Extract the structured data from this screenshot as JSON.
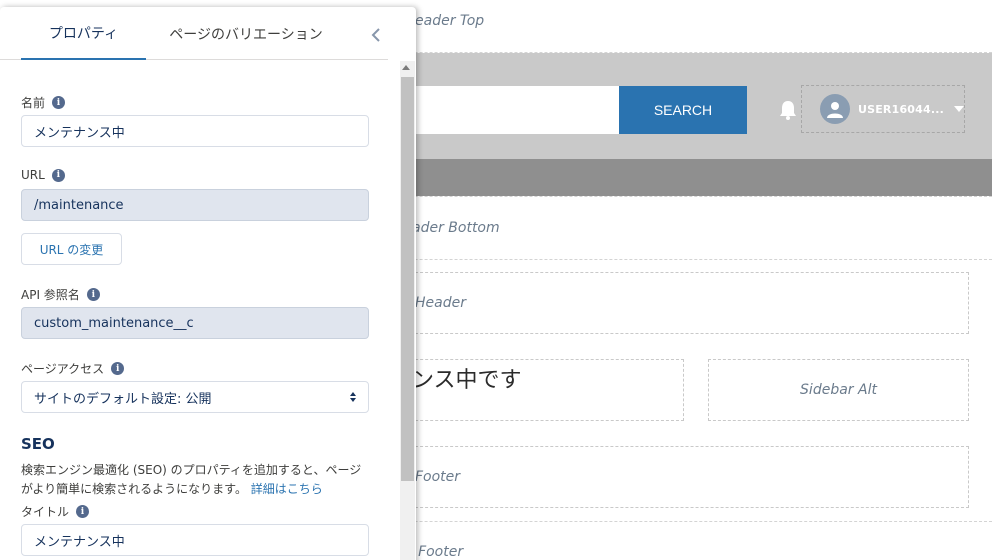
{
  "canvas": {
    "header_top_label": "eader Top",
    "header_bottom_label": "ader Bottom",
    "content_header_label": "Header",
    "main_text": "ンス中です",
    "sidebar_alt_label": "Sidebar Alt",
    "content_footer_label": "Footer",
    "footer_label": "e Footer",
    "search_button_label": "SEARCH",
    "user_name": "USER16044...",
    "icons": [
      "bell-icon",
      "user-avatar-icon",
      "chevron-down-icon"
    ]
  },
  "panel": {
    "tabs": [
      {
        "label": "プロパティ",
        "active": true
      },
      {
        "label": "ページのバリエーション",
        "active": false
      }
    ],
    "collapse_icon": "chevron-left-icon",
    "fields": {
      "name": {
        "label": "名前",
        "value": "メンテナンス中"
      },
      "url": {
        "label": "URL",
        "value": "/maintenance"
      },
      "url_change_button": "URL の変更",
      "api_name": {
        "label": "API 参照名",
        "value": "custom_maintenance__c"
      },
      "page_access": {
        "label": "ページアクセス",
        "value": "サイトのデフォルト設定: 公開"
      }
    },
    "seo": {
      "heading": "SEO",
      "description": "検索エンジン最適化 (SEO) のプロパティを追加すると、ページがより簡単に検索されるようになります。",
      "link": "詳細はこちら",
      "title_label": "タイトル",
      "title_value": "メンテナンス中"
    }
  },
  "colors": {
    "accent": "#2a73b0",
    "header_bg": "#c9c9c9",
    "nav_bg": "#8f8f8f",
    "readonly_bg": "#e0e5ee"
  }
}
